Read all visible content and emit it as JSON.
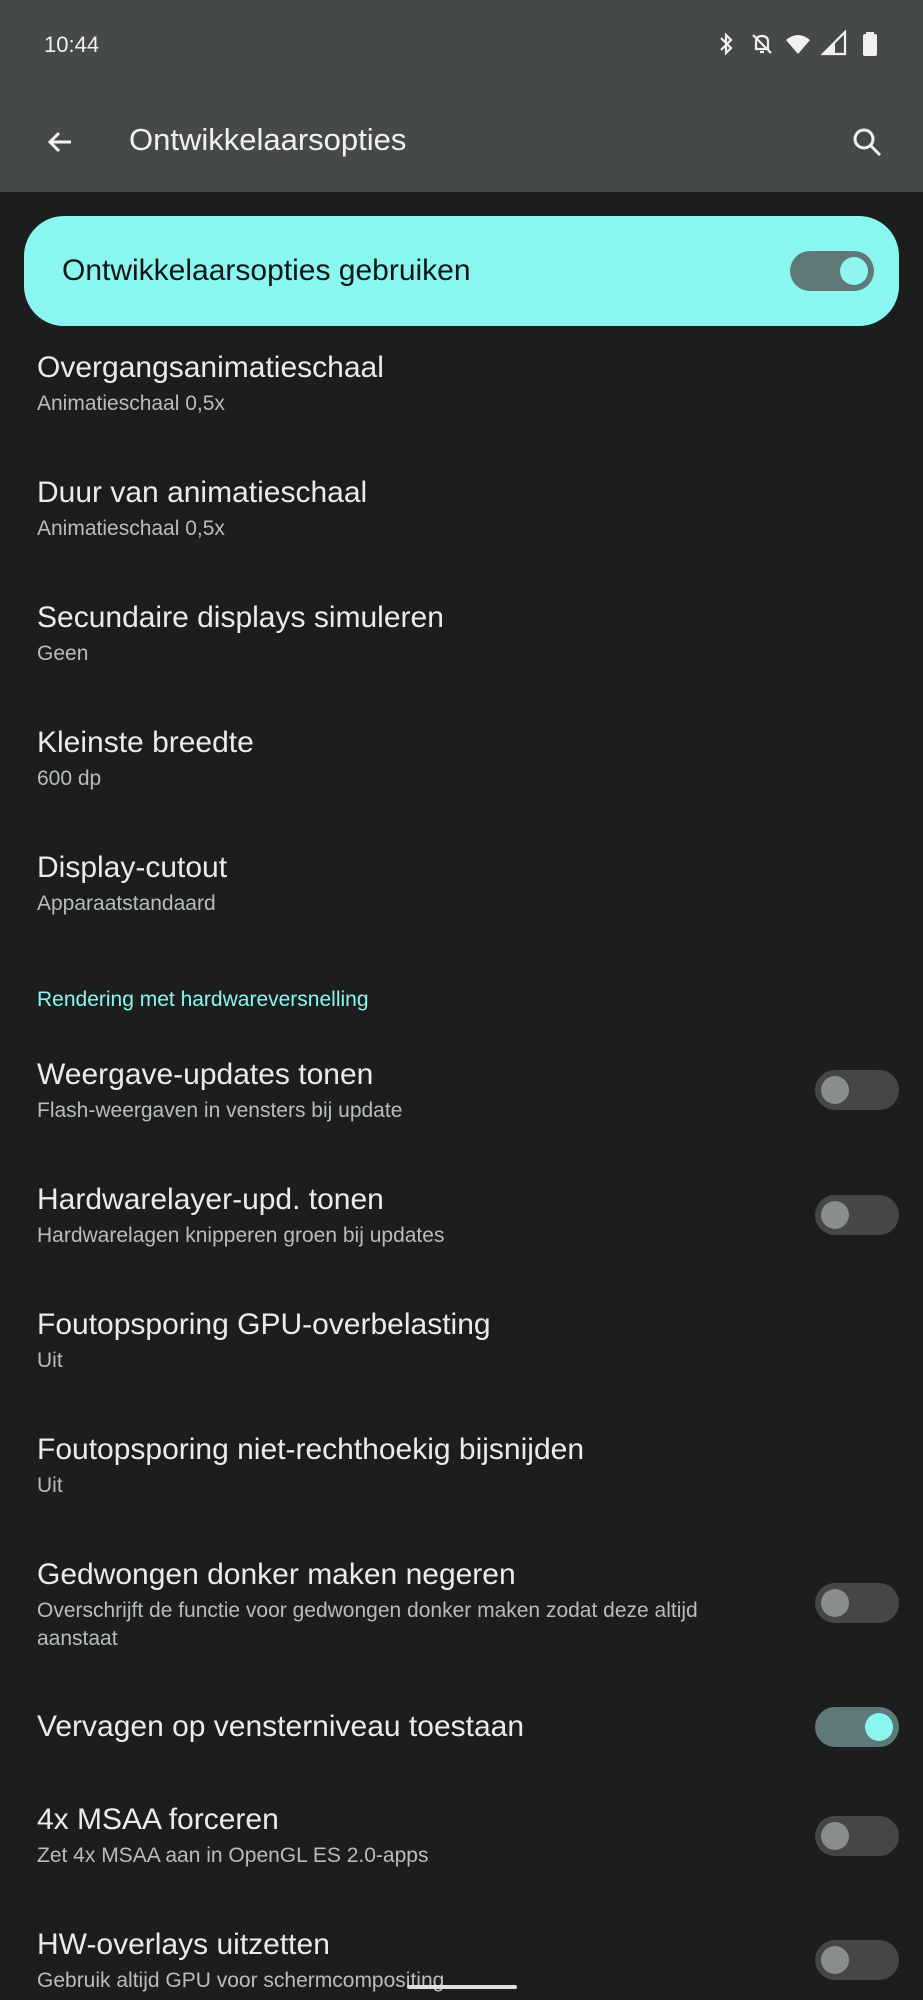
{
  "status": {
    "time": "10:44"
  },
  "appbar": {
    "title": "Ontwikkelaarsopties"
  },
  "main_switch": {
    "label": "Ontwikkelaarsopties gebruiken",
    "on": true
  },
  "items": [
    {
      "title": "Overgangsanimatieschaal",
      "subtitle": "Animatieschaal 0,5x"
    },
    {
      "title": "Duur van animatieschaal",
      "subtitle": "Animatieschaal 0,5x"
    },
    {
      "title": "Secundaire displays simuleren",
      "subtitle": "Geen"
    },
    {
      "title": "Kleinste breedte",
      "subtitle": "600 dp"
    },
    {
      "title": "Display-cutout",
      "subtitle": "Apparaatstandaard"
    }
  ],
  "section": {
    "title": "Rendering met hardwareversnelling"
  },
  "render_items": [
    {
      "title": "Weergave-updates tonen",
      "subtitle": "Flash-weergaven in vensters bij update",
      "toggle": false
    },
    {
      "title": "Hardwarelayer-upd. tonen",
      "subtitle": "Hardwarelagen knipperen groen bij updates",
      "toggle": false
    },
    {
      "title": "Foutopsporing GPU-overbelasting",
      "subtitle": "Uit"
    },
    {
      "title": "Foutopsporing niet-rechthoekig bijsnijden",
      "subtitle": "Uit"
    },
    {
      "title": "Gedwongen donker maken negeren",
      "subtitle": "Overschrijft de functie voor gedwongen donker maken zodat deze altijd aanstaat",
      "toggle": false
    },
    {
      "title": "Vervagen op vensterniveau toestaan",
      "subtitle": "",
      "toggle": true
    },
    {
      "title": "4x MSAA forceren",
      "subtitle": "Zet 4x MSAA aan in OpenGL ES 2.0-apps",
      "toggle": false
    },
    {
      "title": "HW-overlays uitzetten",
      "subtitle": "Gebruik altijd GPU voor schermcompositing",
      "toggle": false
    }
  ],
  "colors": {
    "accent": "#89f6f0",
    "background": "#1c1e1e",
    "bar": "#46494a"
  },
  "icons": [
    "bluetooth-icon",
    "notifications-off-icon",
    "wifi-icon",
    "signal-icon",
    "battery-icon",
    "back-arrow-icon",
    "search-icon"
  ]
}
